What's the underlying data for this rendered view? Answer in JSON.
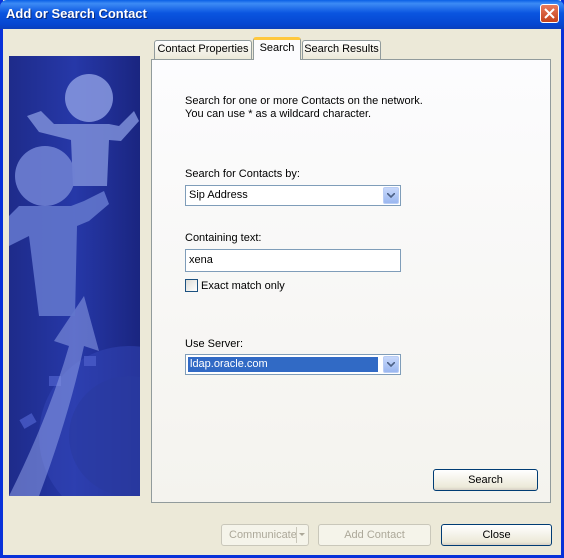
{
  "window": {
    "title": "Add or Search Contact"
  },
  "tabs": [
    {
      "label": "Contact Properties"
    },
    {
      "label": "Search"
    },
    {
      "label": "Search Results"
    }
  ],
  "search_panel": {
    "intro_line1": "Search for one or more Contacts on the network.",
    "intro_line2": "You can use *  as a wildcard character.",
    "search_by_label": "Search for Contacts by:",
    "search_by_value": "Sip Address",
    "containing_label": "Containing text:",
    "containing_value": "xena",
    "exact_match_label": "Exact match only",
    "exact_match_checked": false,
    "use_server_label": "Use Server:",
    "use_server_value": "ldap.oracle.com",
    "search_button": "Search"
  },
  "footer": {
    "communicate_button": "Communicate",
    "add_contact_button": "Add Contact",
    "close_button": "Close"
  },
  "colors": {
    "titlebar": "#0a55e0",
    "selection": "#316ac5",
    "dialog_bg": "#ece9d8",
    "side_art": "#2638a8"
  }
}
